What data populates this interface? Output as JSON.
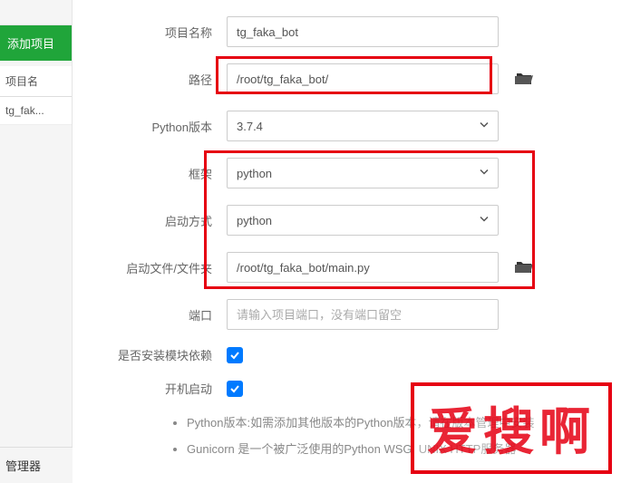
{
  "sidebar": {
    "active_tab": "添加项目",
    "header": "项目名",
    "items": [
      "tg_fak..."
    ],
    "bottom": "管理器"
  },
  "form": {
    "project_name": {
      "label": "项目名称",
      "value": "tg_faka_bot"
    },
    "path": {
      "label": "路径",
      "value": "/root/tg_faka_bot/"
    },
    "python_version": {
      "label": "Python版本",
      "value": "3.7.4"
    },
    "framework": {
      "label": "框架",
      "value": "python"
    },
    "start_mode": {
      "label": "启动方式",
      "value": "python"
    },
    "start_file": {
      "label": "启动文件/文件夹",
      "value": "/root/tg_faka_bot/main.py"
    },
    "port": {
      "label": "端口",
      "placeholder": "请输入项目端口，没有端口留空"
    },
    "install_deps": {
      "label": "是否安装模块依赖"
    },
    "autostart": {
      "label": "开机启动"
    }
  },
  "notes": [
    "Python版本:如需添加其他版本的Python版本，请在版本管理中安装",
    "Gunicorn 是一个被广泛使用的Python WSGI UNIX HTTP服务器"
  ],
  "watermark": "爱搜啊"
}
